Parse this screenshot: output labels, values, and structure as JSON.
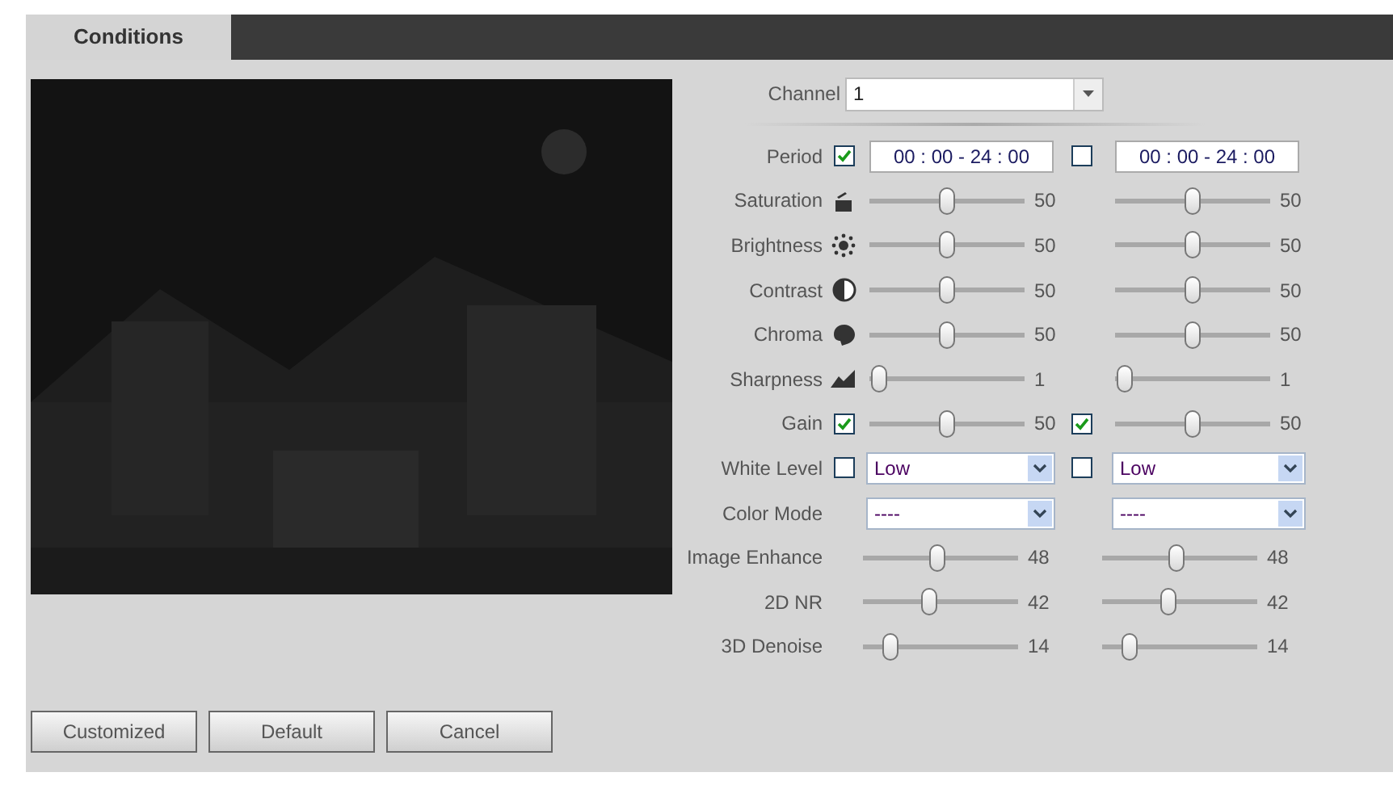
{
  "tabs": [
    {
      "label": "Conditions",
      "selected": true
    }
  ],
  "channel": {
    "label": "Channel",
    "value": "1"
  },
  "rows": [
    {
      "kind": "period",
      "label": "Period",
      "sides": [
        {
          "checked": true,
          "value": "00 : 00 - 24 : 00"
        },
        {
          "checked": false,
          "value": "00 : 00 - 24 : 00"
        }
      ]
    },
    {
      "kind": "slider",
      "label": "Saturation",
      "sides": [
        {
          "level": 0.5,
          "reading": "50"
        },
        {
          "level": 0.5,
          "reading": "50"
        }
      ]
    },
    {
      "kind": "slider",
      "label": "Brightness",
      "sides": [
        {
          "level": 0.5,
          "reading": "50"
        },
        {
          "level": 0.5,
          "reading": "50"
        }
      ]
    },
    {
      "kind": "slider",
      "label": "Contrast",
      "sides": [
        {
          "level": 0.5,
          "reading": "50"
        },
        {
          "level": 0.5,
          "reading": "50"
        }
      ]
    },
    {
      "kind": "slider",
      "label": "Chroma",
      "sides": [
        {
          "level": 0.5,
          "reading": "50"
        },
        {
          "level": 0.5,
          "reading": "50"
        }
      ]
    },
    {
      "kind": "slider",
      "label": "Sharpness",
      "sides": [
        {
          "level": 0.01,
          "reading": "1"
        },
        {
          "level": 0.01,
          "reading": "1"
        }
      ]
    },
    {
      "kind": "slider",
      "label": "Gain",
      "sides": [
        {
          "checked": true,
          "level": 0.5,
          "reading": "50"
        },
        {
          "checked": true,
          "level": 0.5,
          "reading": "50"
        }
      ]
    },
    {
      "kind": "dropdown",
      "label": "White Level",
      "sides": [
        {
          "checked": false,
          "value": "Low"
        },
        {
          "checked": false,
          "value": "Low"
        }
      ]
    },
    {
      "kind": "dropdown",
      "label": "Color Mode",
      "sides": [
        {
          "value": "----"
        },
        {
          "value": "----"
        }
      ]
    },
    {
      "kind": "slider",
      "label": "Image Enhance",
      "sides": [
        {
          "level": 0.48,
          "reading": "48"
        },
        {
          "level": 0.48,
          "reading": "48"
        }
      ]
    },
    {
      "kind": "slider",
      "label": "2D NR",
      "sides": [
        {
          "level": 0.42,
          "reading": "42"
        },
        {
          "level": 0.42,
          "reading": "42"
        }
      ]
    },
    {
      "kind": "slider",
      "label": "3D Denoise",
      "sides": [
        {
          "level": 0.14,
          "reading": "14"
        },
        {
          "level": 0.14,
          "reading": "14"
        }
      ]
    }
  ],
  "buttons": [
    "Customized",
    "Default",
    "Cancel"
  ]
}
